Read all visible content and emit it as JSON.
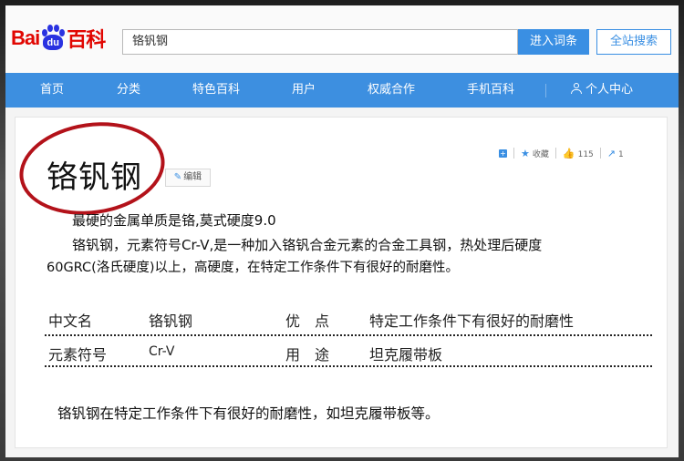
{
  "logo": {
    "left": "Bai",
    "paw": "du",
    "right": "百科"
  },
  "search": {
    "value": "铬钒钢"
  },
  "buttons": {
    "enter": "进入词条",
    "site_search": "全站搜索"
  },
  "nav": {
    "items": [
      "首页",
      "分类",
      "特色百科",
      "用户",
      "权威合作",
      "手机百科"
    ],
    "user_center": "个人中心"
  },
  "entry": {
    "title": "铬钒钢",
    "edit_label": "编辑",
    "tools": {
      "favorite_label": "收藏",
      "like_count": "115",
      "share_count": "1"
    },
    "summary_line1": "最硬的金属单质是铬,莫式硬度9.0",
    "summary_line2": "铬钒钢，元素符号Cr-V,是一种加入铬钒合金元素的合金工具钢，热处理后硬度",
    "summary_line3": "60GRC(洛氏硬度)以上，高硬度，在特定工作条件下有很好的耐磨性。",
    "basic_info": [
      {
        "label1": "中文名",
        "value1": "铬钒钢",
        "label2": "优　点",
        "value2": "特定工作条件下有很好的耐磨性"
      },
      {
        "label1": "元素符号",
        "value1": "Cr-V",
        "label2": "用　途",
        "value2": "坦克履带板"
      }
    ],
    "footer_text": "铬钒钢在特定工作条件下有很好的耐磨性，如坦克履带板等。"
  },
  "colors": {
    "brand_red": "#e10601",
    "brand_blue": "#2932e1",
    "nav_blue": "#3d8fe0",
    "annotation_red": "#b3121a"
  }
}
